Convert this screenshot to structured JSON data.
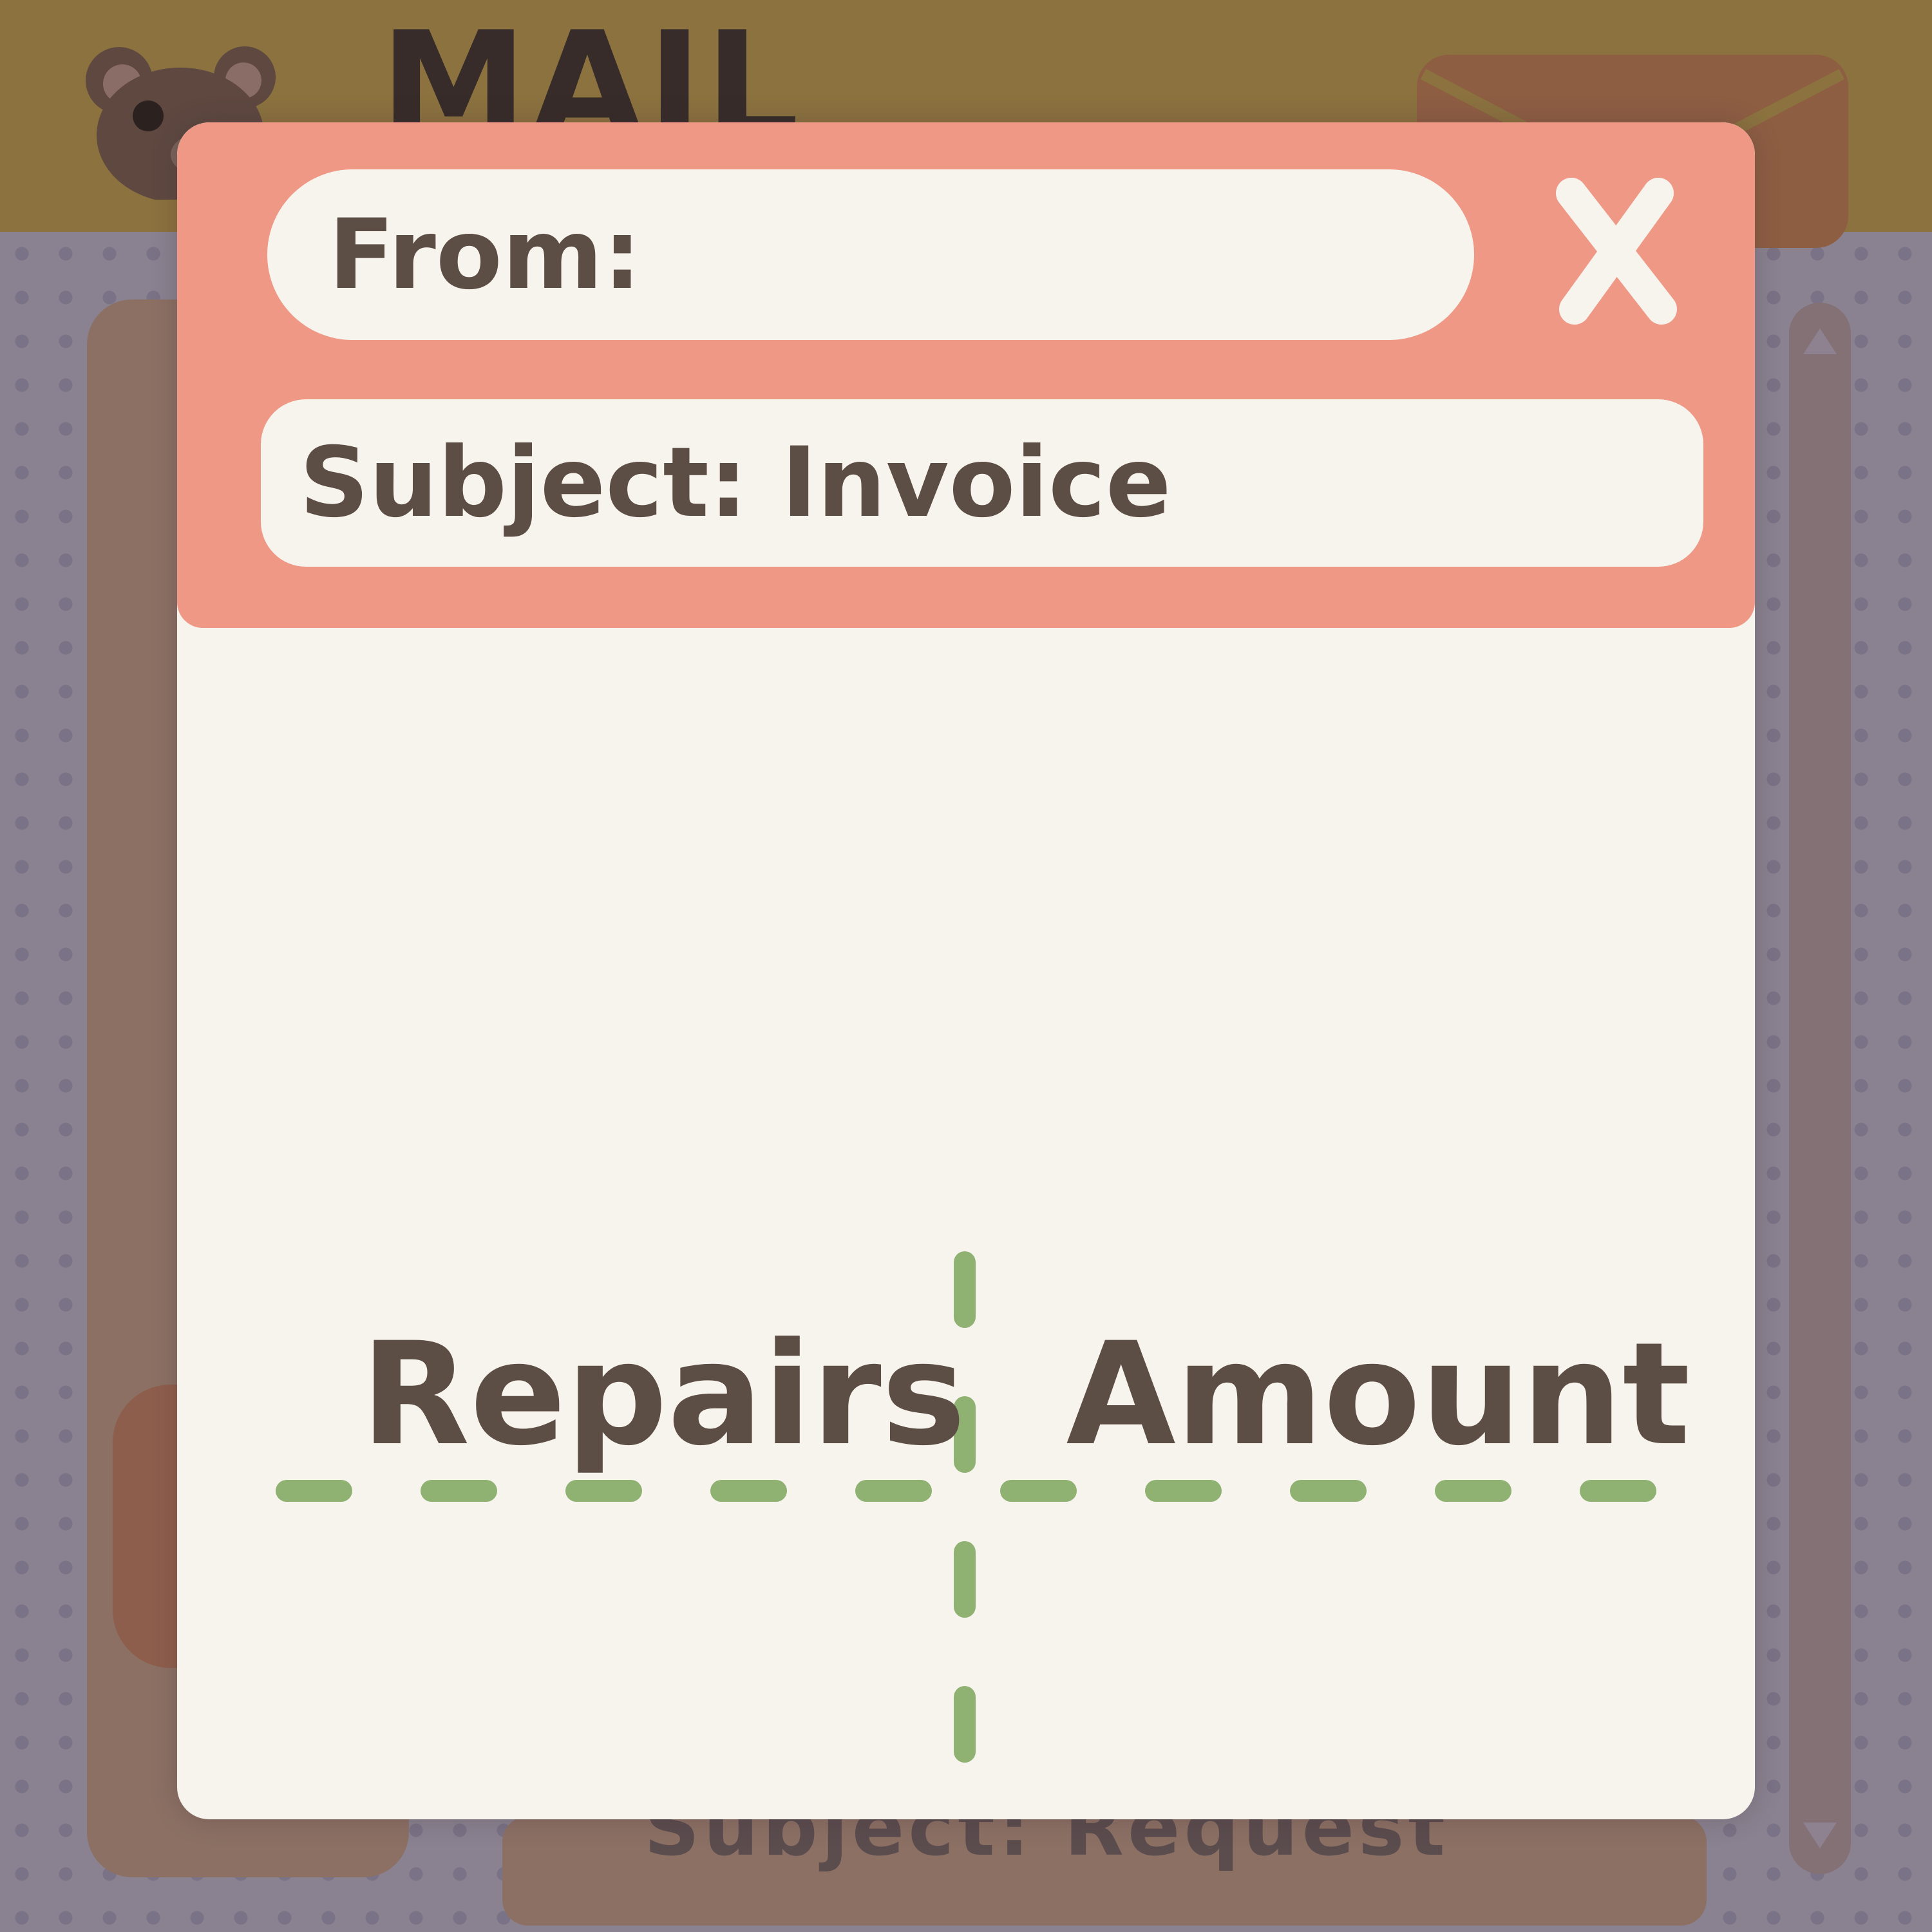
{
  "background": {
    "app_title": "MAIL",
    "partial_subject": "Subject: Request"
  },
  "modal": {
    "from_label": "From:",
    "subject_label": "Subject: Invoice",
    "close_label": "X",
    "table": {
      "columns": [
        "Repairs",
        "Amount"
      ]
    }
  },
  "colors": {
    "header": "#ef9886",
    "paper": "#f7f3ed",
    "text": "#5c4d45",
    "divider": "#8fb272",
    "topbar": "#8b723f"
  },
  "icons": {
    "mascot": "bear-icon",
    "mail": "envelope-icon",
    "close": "close-icon"
  }
}
